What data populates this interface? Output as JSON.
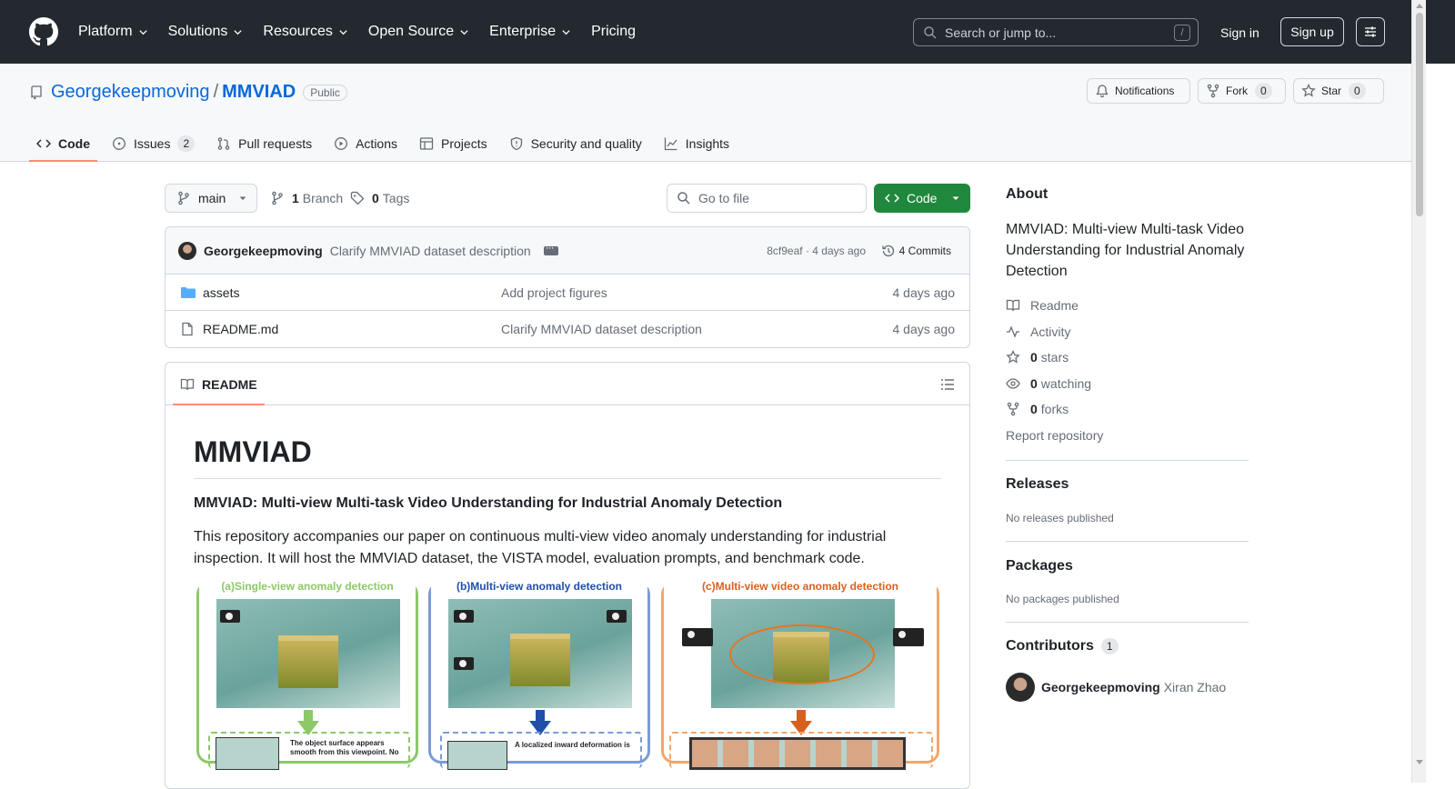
{
  "topnav": {
    "items": [
      "Platform",
      "Solutions",
      "Resources",
      "Open Source",
      "Enterprise",
      "Pricing"
    ],
    "search_placeholder": "Search or jump to...",
    "search_shortcut": "/",
    "sign_in": "Sign in",
    "sign_up": "Sign up"
  },
  "repo": {
    "owner": "Georgekeepmoving",
    "separator": "/",
    "name": "MMVIAD",
    "visibility": "Public",
    "notifications_label": "Notifications",
    "fork_label": "Fork",
    "fork_count": "0",
    "star_label": "Star",
    "star_count": "0"
  },
  "tabs": [
    {
      "label": "Code"
    },
    {
      "label": "Issues",
      "count": "2"
    },
    {
      "label": "Pull requests"
    },
    {
      "label": "Actions"
    },
    {
      "label": "Projects"
    },
    {
      "label": "Security and quality"
    },
    {
      "label": "Insights"
    }
  ],
  "branchbar": {
    "branch": "main",
    "branch_count": "1",
    "branch_label": "Branch",
    "tag_count": "0",
    "tag_label": "Tags",
    "goto_placeholder": "Go to file",
    "code_button": "Code"
  },
  "commit": {
    "author": "Georgekeepmoving",
    "message": "Clarify MMVIAD dataset description",
    "sha_age": "8cf9eaf · 4 days ago",
    "commits": "4 Commits"
  },
  "files": [
    {
      "name": "assets",
      "type": "folder",
      "message": "Add project figures",
      "age": "4 days ago"
    },
    {
      "name": "README.md",
      "type": "file",
      "message": "Clarify MMVIAD dataset description",
      "age": "4 days ago"
    }
  ],
  "readme": {
    "tab": "README",
    "title": "MMVIAD",
    "subtitle": "MMVIAD: Multi-view Multi-task Video Understanding for Industrial Anomaly Detection",
    "paragraph": "This repository accompanies our paper on continuous multi-view video anomaly understanding for industrial inspection. It will host the MMVIAD dataset, the VISTA model, evaluation prompts, and benchmark code.",
    "figure_panels": [
      {
        "title": "(a)Single-view anomaly detection",
        "color": "#8dc869",
        "arrow": "#8dc869"
      },
      {
        "title": "(b)Multi-view anomaly detection",
        "color": "#7b9bd6",
        "arrow": "#1f4fa8"
      },
      {
        "title": "(c)Multi-view video anomaly detection",
        "color": "#f2a66b",
        "arrow": "#d8601f"
      }
    ],
    "figure_text_a": "The object surface appears smooth from this viewpoint. No",
    "figure_text_b": "A localized inward deformation is"
  },
  "sidebar": {
    "about_title": "About",
    "description": "MMVIAD: Multi-view Multi-task Video Understanding for Industrial Anomaly Detection",
    "readme": "Readme",
    "activity": "Activity",
    "stars_count": "0",
    "stars_label": "stars",
    "watching_count": "0",
    "watching_label": "watching",
    "forks_count": "0",
    "forks_label": "forks",
    "report": "Report repository",
    "releases_title": "Releases",
    "releases_text": "No releases published",
    "packages_title": "Packages",
    "packages_text": "No packages published",
    "contributors_title": "Contributors",
    "contributors_count": "1",
    "contributor_login": "Georgekeepmoving",
    "contributor_name": "Xiran Zhao"
  }
}
